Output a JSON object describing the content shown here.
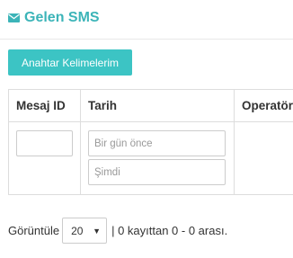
{
  "header": {
    "icon": "envelope-icon",
    "title": "Gelen SMS",
    "accent": "#3cb4b8"
  },
  "toolbar": {
    "keywords_label": "Anahtar Kelimelerim",
    "button_color": "#3cc4c4"
  },
  "table": {
    "columns": [
      "Mesaj ID",
      "Tarih",
      "Operatör"
    ],
    "filters": {
      "message_id": {
        "value": "",
        "placeholder": ""
      },
      "date_from": {
        "value": "",
        "placeholder": "Bir gün önce"
      },
      "date_to": {
        "value": "",
        "placeholder": "Şimdi"
      }
    }
  },
  "pager": {
    "show_label": "Görüntüle",
    "page_size": "20",
    "summary": "| 0 kayıttan 0 - 0 arası."
  }
}
